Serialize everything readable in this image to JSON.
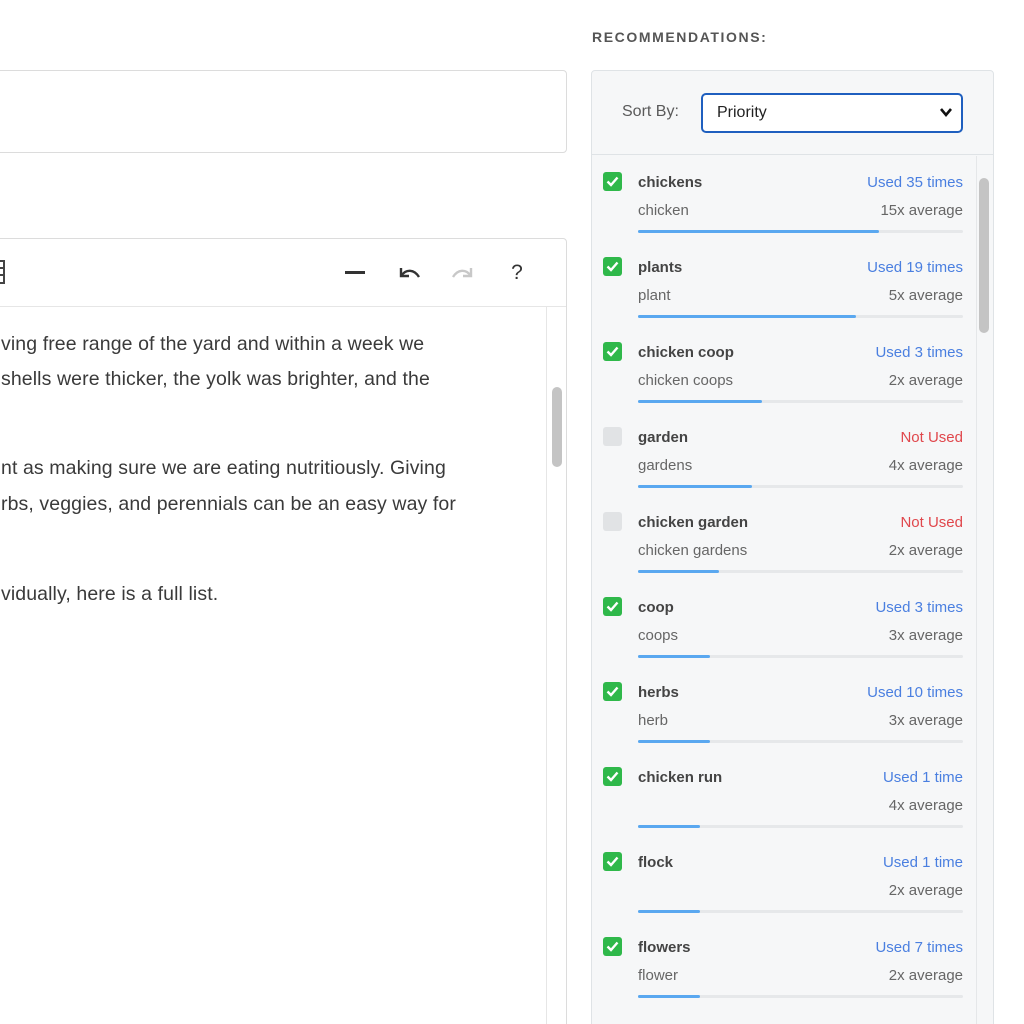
{
  "editor": {
    "title_partial": ",",
    "paragraphs": [
      "ving free range of the yard and within a week we",
      " shells were thicker, the yolk was brighter, and the",
      "nt as making sure we are eating nutritiously. Giving",
      "rbs, veggies, and perennials can be an easy way for",
      "vidually, here is a full list."
    ],
    "toolbar": {
      "help_label": "?"
    }
  },
  "recommendations": {
    "heading": "RECOMMENDATIONS:",
    "sort_label": "Sort By:",
    "sort_value": "Priority",
    "items": [
      {
        "keyword": "chickens",
        "variant": "chicken",
        "usage": "Used 35 times",
        "used": true,
        "average": "15x average",
        "progress": 0.74
      },
      {
        "keyword": "plants",
        "variant": "plant",
        "usage": "Used 19 times",
        "used": true,
        "average": "5x average",
        "progress": 0.67
      },
      {
        "keyword": "chicken coop",
        "variant": "chicken coops",
        "usage": "Used 3 times",
        "used": true,
        "average": "2x average",
        "progress": 0.38
      },
      {
        "keyword": "garden",
        "variant": "gardens",
        "usage": "Not Used",
        "used": false,
        "average": "4x average",
        "progress": 0.35
      },
      {
        "keyword": "chicken garden",
        "variant": "chicken gardens",
        "usage": "Not Used",
        "used": false,
        "average": "2x average",
        "progress": 0.25
      },
      {
        "keyword": "coop",
        "variant": "coops",
        "usage": "Used 3 times",
        "used": true,
        "average": "3x average",
        "progress": 0.22
      },
      {
        "keyword": "herbs",
        "variant": "herb",
        "usage": "Used 10 times",
        "used": true,
        "average": "3x average",
        "progress": 0.22
      },
      {
        "keyword": "chicken run",
        "variant": "",
        "usage": "Used 1 time",
        "used": true,
        "average": "4x average",
        "progress": 0.19
      },
      {
        "keyword": "flock",
        "variant": "",
        "usage": "Used 1 time",
        "used": true,
        "average": "2x average",
        "progress": 0.19
      },
      {
        "keyword": "flowers",
        "variant": "flower",
        "usage": "Used 7 times",
        "used": true,
        "average": "2x average",
        "progress": 0.19
      }
    ]
  },
  "colors": {
    "used": "#4a7fe0",
    "not_used": "#e0474c",
    "check_on": "#2fb84a",
    "bar": "#5aa8f0"
  }
}
